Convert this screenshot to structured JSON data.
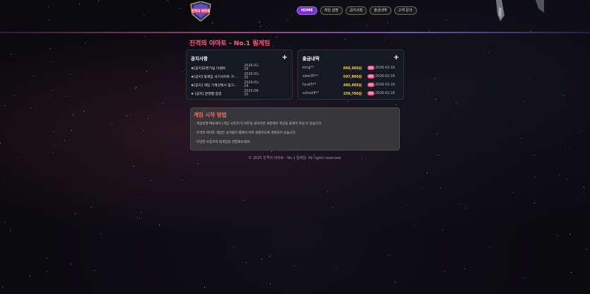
{
  "header": {
    "logo_text": "진격의 야마토",
    "nav": [
      "HOME",
      "게임 설명",
      "공지사항",
      "출금내역",
      "고객 문의"
    ]
  },
  "page_title": "진격의 야마토 - No.1 릴게임",
  "notices": {
    "title": "공지사항",
    "plus": "+",
    "items": [
      {
        "title": "★[공지]오픈기념 이벤트",
        "date": "2026-01-29"
      },
      {
        "title": "★[공지] 릴게임 사기사이트 구…",
        "date": "2026-01-25"
      },
      {
        "title": "★[공지] 게임 기계선택시 참고…",
        "date": "2026-01-24"
      },
      {
        "title": "★ [공지] 운영별 점검",
        "date": "2025-06-15"
      }
    ]
  },
  "payouts": {
    "title": "출금내역",
    "plus": "+",
    "badge": "완료",
    "items": [
      {
        "name": "kimjj**",
        "amount": "860,400원",
        "date": "2026-02-16"
      },
      {
        "name": "sjwe35**",
        "amount": "597,800원",
        "date": "2026-02-16"
      },
      {
        "name": "hyuk5**",
        "amount": "480,400원",
        "date": "2026-02-16"
      },
      {
        "name": "school9**",
        "amount": "259,700원",
        "date": "2026-02-16"
      }
    ]
  },
  "guide": {
    "title": "게임 시작 방법",
    "lines": [
      "- 게임실행 메뉴에서 [게임 시작하기] 버튼을 클릭하면 새창에서 게임을 플레이 하실 수 있습니다.",
      "- 진격의 야마토 게임은 설치없이 웹에서 바로 실행하도록 개발되어 있습니다.",
      "- 다양한 보징코와 릴게임을 경험해보세요!"
    ]
  },
  "footer": "© 2025 진격의 야마토 - No.1 릴게임. All rights reserved.",
  "colors": {
    "accent": "#7a2fd1",
    "title": "#ff5e86",
    "amount": "#ffcc33",
    "badge": "#ff4d8a"
  }
}
